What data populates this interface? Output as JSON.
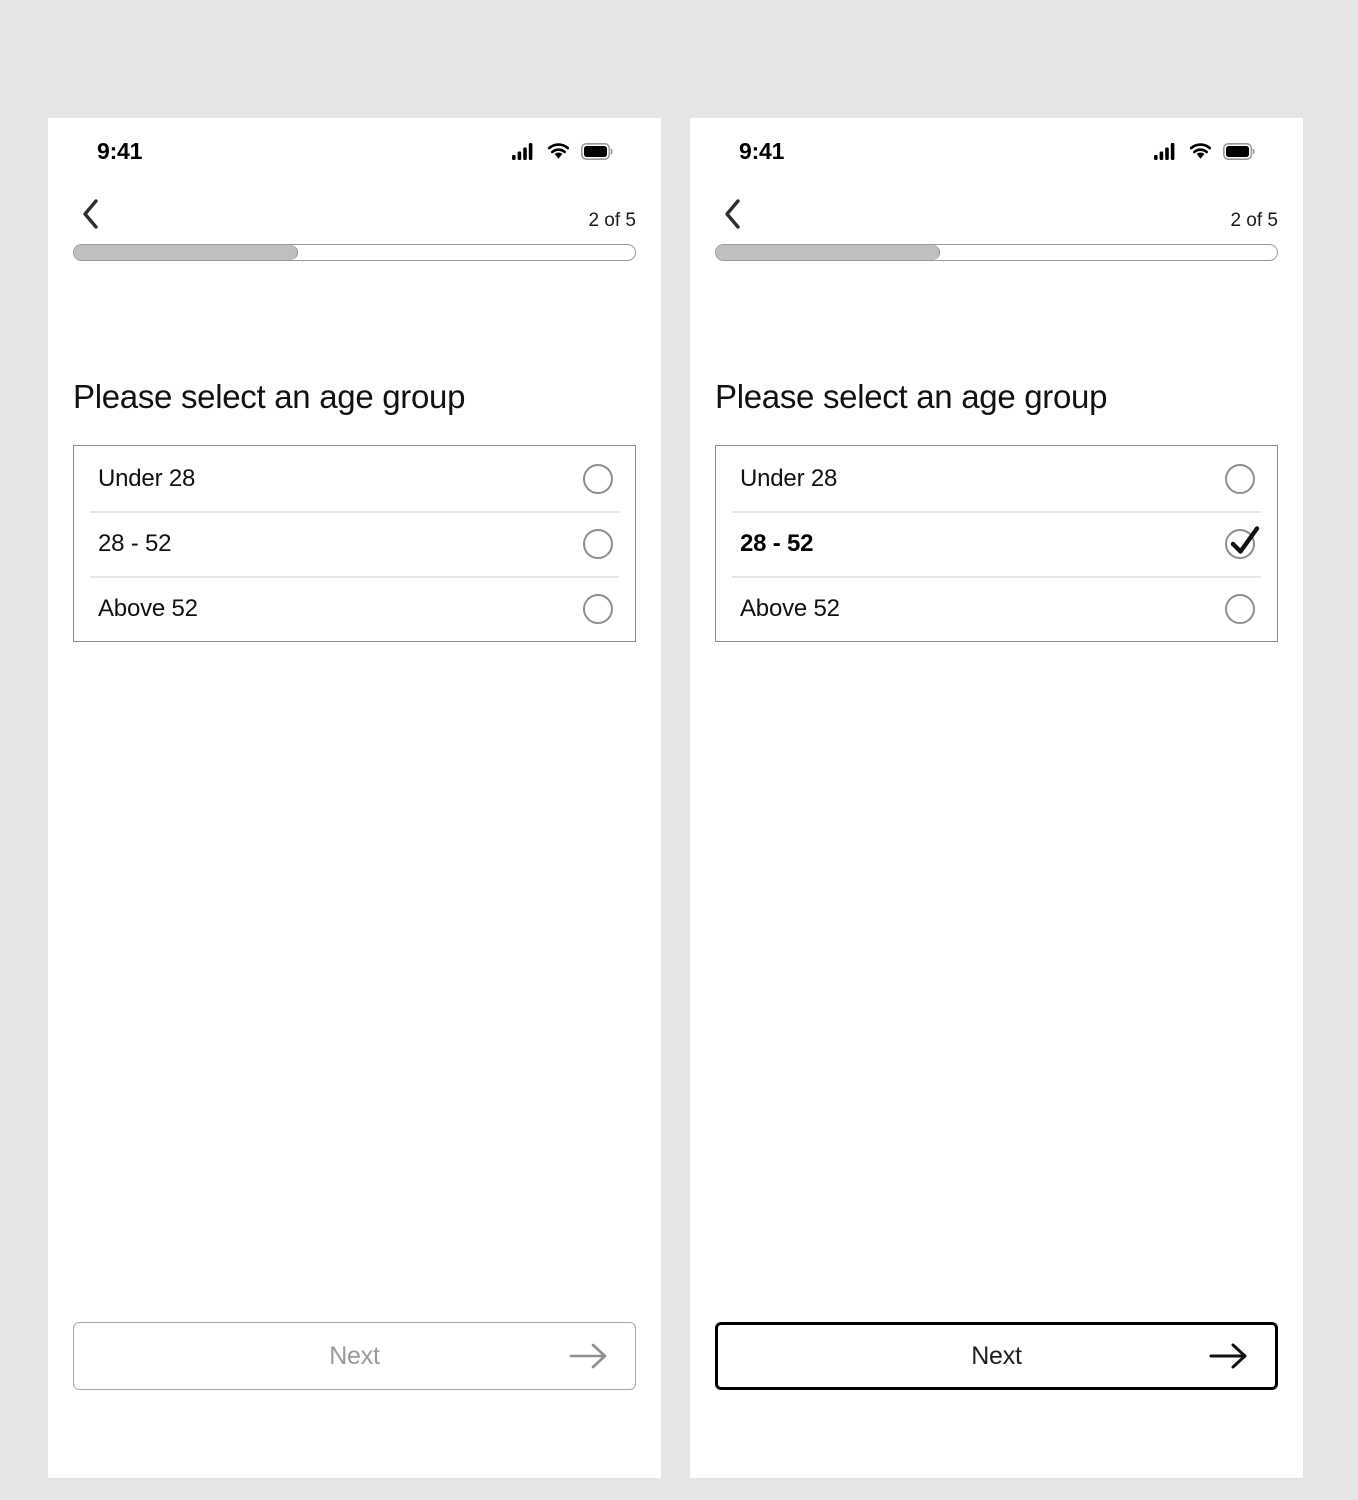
{
  "background_color": "#e5e5e5",
  "panels": [
    {
      "variant": "unselected-state",
      "status_bar": {
        "time": "9:41",
        "icons": [
          "cellular-signal-icon",
          "wifi-icon",
          "battery-icon"
        ]
      },
      "nav": {
        "back_icon": "chevron-left-icon",
        "step_label": "2 of 5",
        "progress_percent": 40
      },
      "question": "Please select an age group",
      "options": [
        {
          "label": "Under 28",
          "selected": false
        },
        {
          "label": "28 - 52",
          "selected": false
        },
        {
          "label": "Above 52",
          "selected": false
        }
      ],
      "next_button": {
        "label": "Next",
        "enabled": false,
        "arrow_icon": "arrow-right-icon"
      }
    },
    {
      "variant": "selected-state",
      "status_bar": {
        "time": "9:41",
        "icons": [
          "cellular-signal-icon",
          "wifi-icon",
          "battery-icon"
        ]
      },
      "nav": {
        "back_icon": "chevron-left-icon",
        "step_label": "2 of 5",
        "progress_percent": 40
      },
      "question": "Please select an age group",
      "options": [
        {
          "label": "Under 28",
          "selected": false
        },
        {
          "label": "28 - 52",
          "selected": true
        },
        {
          "label": "Above 52",
          "selected": false
        }
      ],
      "next_button": {
        "label": "Next",
        "enabled": true,
        "arrow_icon": "arrow-right-icon"
      }
    }
  ],
  "colors": {
    "background": "#e5e5e5",
    "panel": "#ffffff",
    "text_primary": "#111111",
    "text_muted": "#9a9a9a",
    "border": "#8c8c8c",
    "divider": "#e6e6e6",
    "progress_fill": "#bfbfbf",
    "accent": "#000000"
  }
}
